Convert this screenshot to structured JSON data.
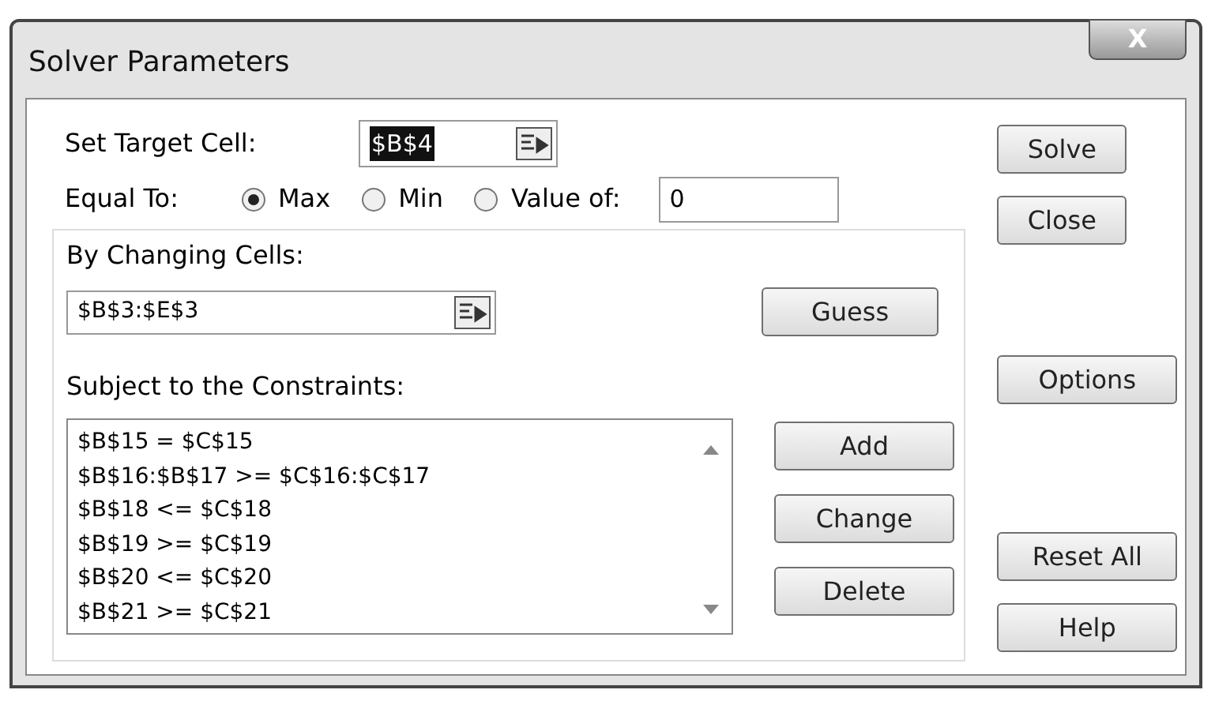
{
  "window": {
    "title": "Solver Parameters",
    "close": "X"
  },
  "target": {
    "label": "Set Target Cell:",
    "value": "$B$4",
    "selected": true
  },
  "equal_to": {
    "label": "Equal To:",
    "options": [
      {
        "label": "Max",
        "selected": true
      },
      {
        "label": "Min",
        "selected": false
      },
      {
        "label": "Value of:",
        "selected": false
      }
    ],
    "value": "0"
  },
  "changing": {
    "label": "By Changing Cells:",
    "value": "$B$3:$E$3",
    "button": "Guess"
  },
  "constraints": {
    "label": "Subject to the Constraints:",
    "items": [
      "$B$15 = $C$15",
      "$B$16:$B$17 >= $C$16:$C$17",
      "$B$18 <= $C$18",
      "$B$19 >= $C$19",
      "$B$20 <= $C$20",
      "$B$21 >= $C$21"
    ],
    "buttons": [
      "Add",
      "Change",
      "Delete"
    ]
  },
  "side_buttons": {
    "top": [
      "Solve",
      "Close"
    ],
    "middle": [
      "Options"
    ],
    "bottom": [
      "Reset All",
      "Help"
    ]
  }
}
